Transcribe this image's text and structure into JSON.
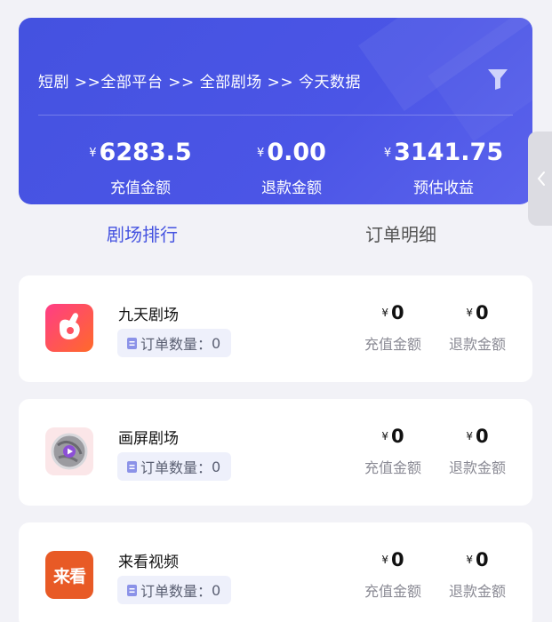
{
  "summary": {
    "breadcrumb": "短剧 >>全部平台 >> 全部剧场 >> 今天数据",
    "currency": "¥",
    "stats": [
      {
        "value": "6283.5",
        "label": "充值金额"
      },
      {
        "value": "0.00",
        "label": "退款金额"
      },
      {
        "value": "3141.75",
        "label": "预估收益"
      }
    ]
  },
  "tabs": [
    {
      "label": "剧场排行",
      "active": true
    },
    {
      "label": "订单明细",
      "active": false
    }
  ],
  "theaters": [
    {
      "name": "九天剧场",
      "count_label": "订单数量：",
      "count": "0",
      "recharge": "0",
      "refund": "0",
      "logo_icon": "fist-app-icon",
      "logo_color": "#f4503a"
    },
    {
      "name": "画屏剧场",
      "count_label": "订单数量：",
      "count": "0",
      "recharge": "0",
      "refund": "0",
      "logo_icon": "globe-play-icon",
      "logo_color": "#fbe6e8"
    },
    {
      "name": "来看视频",
      "count_label": "订单数量：",
      "count": "0",
      "recharge": "0",
      "refund": "0",
      "logo_icon": "laikan-logo",
      "logo_text": "来看",
      "logo_color": "#e85a26"
    }
  ],
  "metric_labels": {
    "recharge": "充值金额",
    "refund": "退款金额"
  },
  "colors": {
    "accent": "#4452e0",
    "background": "#f2f2f7",
    "badge_bg": "#eef0fb"
  }
}
